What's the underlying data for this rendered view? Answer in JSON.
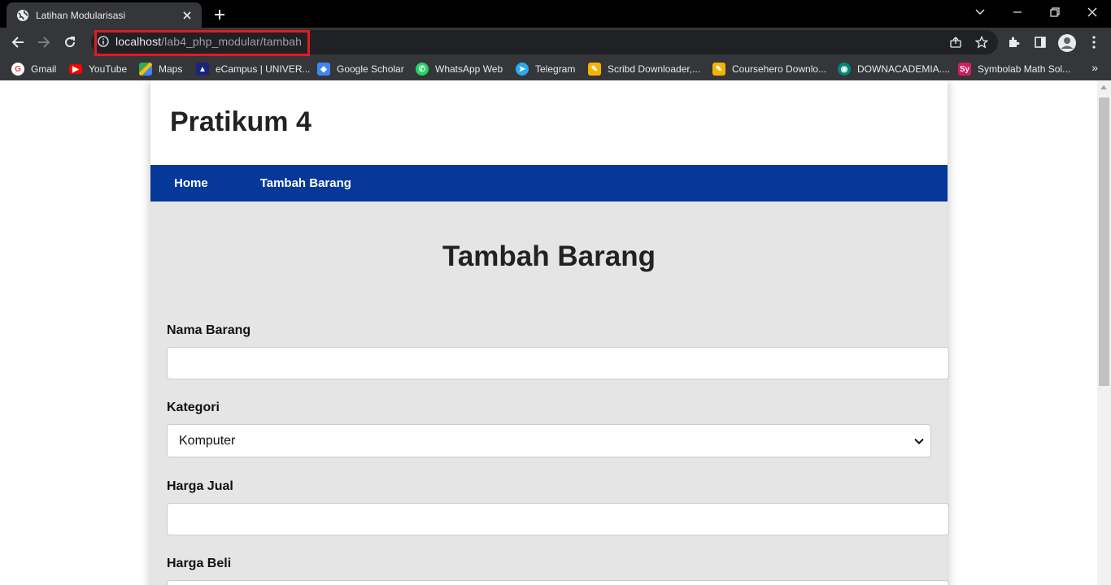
{
  "browser": {
    "tab_title": "Latihan Modularisasi",
    "url_host": "localhost",
    "url_path": "/lab4_php_modular/tambah",
    "bookmarks": [
      {
        "label": "Gmail",
        "icon": "gmail-icon",
        "color": "#ea4335"
      },
      {
        "label": "YouTube",
        "icon": "youtube-icon",
        "color": "#ff0000"
      },
      {
        "label": "Maps",
        "icon": "maps-icon",
        "color": "#34a853"
      },
      {
        "label": "eCampus | UNIVER...",
        "icon": "ecampus-icon",
        "color": "#1a237e"
      },
      {
        "label": "Google Scholar",
        "icon": "scholar-icon",
        "color": "#4285f4"
      },
      {
        "label": "WhatsApp Web",
        "icon": "whatsapp-icon",
        "color": "#25d366"
      },
      {
        "label": "Telegram",
        "icon": "telegram-icon",
        "color": "#2aabee"
      },
      {
        "label": "Scribd Downloader,...",
        "icon": "scribd-icon",
        "color": "#f4b400"
      },
      {
        "label": "Coursehero Downlo...",
        "icon": "coursehero-icon",
        "color": "#f4b400"
      },
      {
        "label": "DOWNACADEMIA....",
        "icon": "downacademia-icon",
        "color": "#00897b"
      },
      {
        "label": "Symbolab Math Sol...",
        "icon": "symbolab-icon",
        "color": "#d81b60",
        "badge": "Sy"
      }
    ]
  },
  "page": {
    "site_title": "Pratikum 4",
    "nav": {
      "home": "Home",
      "tambah": "Tambah Barang"
    },
    "heading": "Tambah Barang",
    "form": {
      "nama_label": "Nama Barang",
      "nama_value": "",
      "kategori_label": "Kategori",
      "kategori_selected": "Komputer",
      "harga_jual_label": "Harga Jual",
      "harga_jual_value": "",
      "harga_beli_label": "Harga Beli",
      "harga_beli_value": ""
    }
  },
  "colors": {
    "nav_bg": "#06389a",
    "content_bg": "#e5e5e5",
    "url_highlight": "#e01a24"
  }
}
